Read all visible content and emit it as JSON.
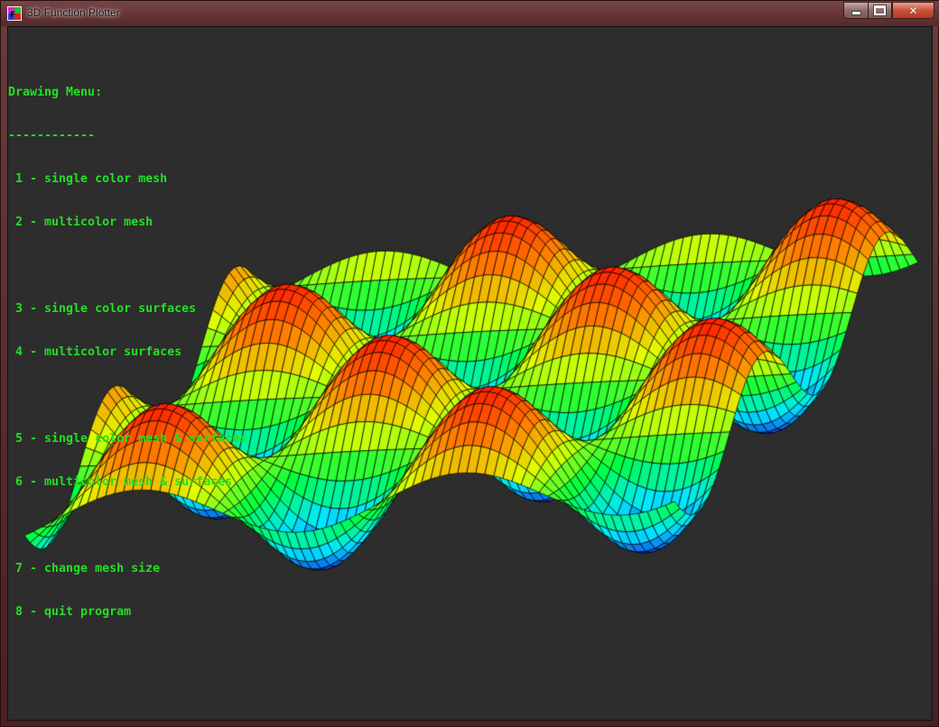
{
  "window": {
    "title": "3D Function Plotter",
    "controls": {
      "minimize": "minimize",
      "maximize": "maximize",
      "close": "✕"
    }
  },
  "menu": {
    "heading": "Drawing Menu:",
    "underline": "------------",
    "items": [
      {
        "text": " 1 - single color mesh"
      },
      {
        "text": " 2 - multicolor mesh"
      },
      {
        "text": " 3 - single color surfaces"
      },
      {
        "text": " 4 - multicolor surfaces"
      },
      {
        "text": " 5 - single color mesh & surfaces"
      },
      {
        "text": " 6 - multicolor mesh & surfaces"
      },
      {
        "text": " 7 - change mesh size"
      },
      {
        "text": " 8 - quit program"
      }
    ]
  },
  "colors": {
    "background": "#2d2d2d",
    "menu_text": "#22e022",
    "mesh_lines": "#000000"
  },
  "plot": {
    "surface": "sin wave ridges",
    "colormap": [
      "#1030e0",
      "#00e8ff",
      "#00ff40",
      "#e0ff00",
      "#ff8000",
      "#ff2000"
    ]
  }
}
